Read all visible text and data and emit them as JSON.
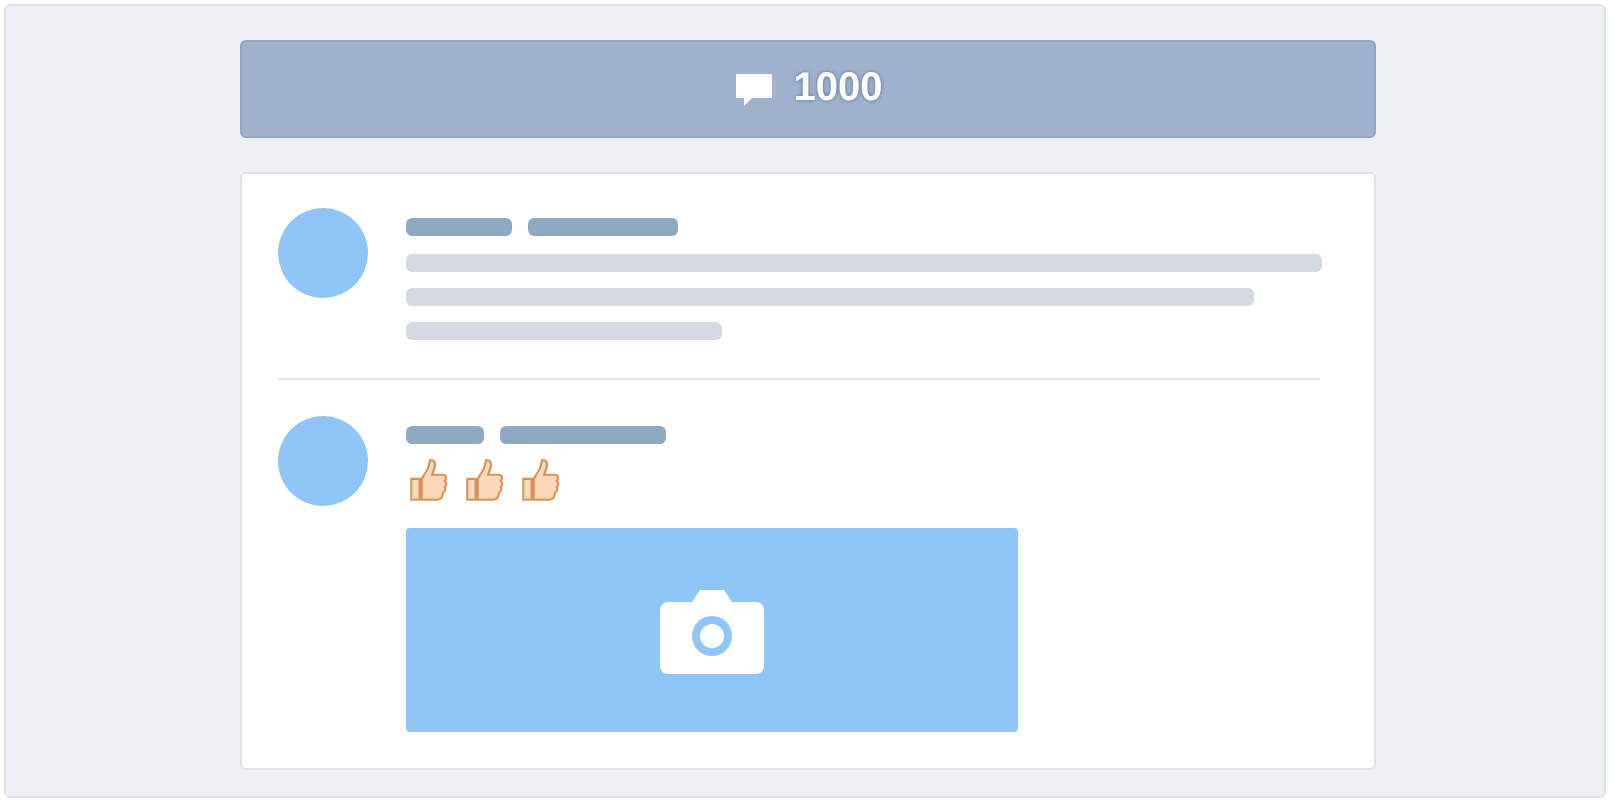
{
  "header": {
    "comment_count": "1000"
  },
  "posts": [
    {
      "kind": "text"
    },
    {
      "kind": "photo",
      "reactions": [
        {
          "kind": "thumbs-up"
        },
        {
          "kind": "thumbs-up"
        },
        {
          "kind": "thumbs-up"
        }
      ],
      "attachment": {
        "kind": "photo-placeholder"
      }
    }
  ]
}
